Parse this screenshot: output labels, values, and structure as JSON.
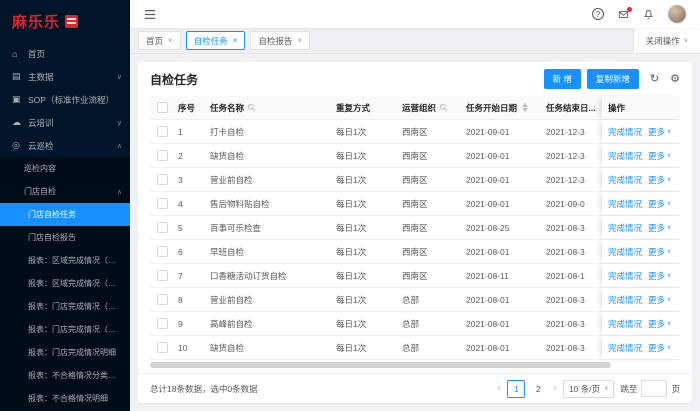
{
  "colors": {
    "primary": "#1890ff",
    "sidebar_bg": "#001529",
    "submenu_bg": "#000c17",
    "brand_red": "#e0242d",
    "badge_red": "#f5222d",
    "page_bg": "#f0f2f5"
  },
  "brand": {
    "name": "麻乐乐"
  },
  "topbar": {
    "help_glyph": "?"
  },
  "icons": {
    "home": "⌂",
    "data": "▤",
    "sop": "▣",
    "cloud": "☁",
    "inspect": "◎"
  },
  "sidebar": {
    "items": [
      {
        "label": "首页",
        "icon": "home"
      },
      {
        "label": "主数据",
        "icon": "data",
        "arrow": "down"
      },
      {
        "label": "SOP（标准作业流程）",
        "icon": "sop"
      },
      {
        "label": "云培训",
        "icon": "cloud",
        "arrow": "down"
      },
      {
        "label": "云巡检",
        "icon": "inspect",
        "arrow": "up"
      },
      {
        "label": "巡检内容",
        "indent": 1,
        "sub": true
      },
      {
        "label": "门店自检",
        "indent": 1,
        "sub": true,
        "arrow": "up"
      },
      {
        "label": "门店自检任务",
        "indent": 2,
        "sub": true,
        "active": true
      },
      {
        "label": "门店自检报告",
        "indent": 2,
        "sub": true
      },
      {
        "label": "报表：区域完成情况（汇总）",
        "indent": 2,
        "sub": true
      },
      {
        "label": "报表：区域完成情况（任务）",
        "indent": 2,
        "sub": true
      },
      {
        "label": "报表：门店完成情况（汇总）",
        "indent": 2,
        "sub": true
      },
      {
        "label": "报表：门店完成情况（任务）",
        "indent": 2,
        "sub": true
      },
      {
        "label": "报表：门店完成情况明细",
        "indent": 2,
        "sub": true
      },
      {
        "label": "报表：不合格情况分类汇总",
        "indent": 2,
        "sub": true
      },
      {
        "label": "报表：不合格情况明细",
        "indent": 2,
        "sub": true
      }
    ]
  },
  "tabs": {
    "items": [
      {
        "label": "首页",
        "active": false
      },
      {
        "label": "自检任务",
        "active": true
      },
      {
        "label": "自检报告",
        "active": false
      }
    ],
    "close_menu": "关闭操作"
  },
  "card": {
    "title": "自检任务",
    "add_btn": "新 增",
    "copy_btn": "复制新增"
  },
  "table": {
    "headers": {
      "no": "序号",
      "name": "任务名称",
      "repeat": "重复方式",
      "org": "运营组织",
      "start": "任务开始日期",
      "end": "任务结束日...",
      "ops": "操作"
    },
    "ops": {
      "complete": "完成情况",
      "more": "更多"
    },
    "rows": [
      {
        "no": "1",
        "name": "打卡自检",
        "repeat": "每日1次",
        "org": "西南区",
        "start": "2021-09-01",
        "end": "2021-12-3"
      },
      {
        "no": "2",
        "name": "缺货自检",
        "repeat": "每日1次",
        "org": "西南区",
        "start": "2021-09-01",
        "end": "2021-12-3"
      },
      {
        "no": "3",
        "name": "营业前自检",
        "repeat": "每日1次",
        "org": "西南区",
        "start": "2021-09-01",
        "end": "2021-12-3"
      },
      {
        "no": "4",
        "name": "售后物料贴自检",
        "repeat": "每日1次",
        "org": "西南区",
        "start": "2021-09-01",
        "end": "2021-09-0"
      },
      {
        "no": "5",
        "name": "百事可乐检查",
        "repeat": "每日1次",
        "org": "西南区",
        "start": "2021-08-25",
        "end": "2021-08-3"
      },
      {
        "no": "6",
        "name": "早班自检",
        "repeat": "每日1次",
        "org": "西南区",
        "start": "2021-08-01",
        "end": "2021-08-3"
      },
      {
        "no": "7",
        "name": "口香糖活动订货自检",
        "repeat": "每日1次",
        "org": "西南区",
        "start": "2021-08-11",
        "end": "2021-08-1"
      },
      {
        "no": "8",
        "name": "营业前自检",
        "repeat": "每日1次",
        "org": "总部",
        "start": "2021-08-01",
        "end": "2021-08-3"
      },
      {
        "no": "9",
        "name": "高峰前自检",
        "repeat": "每日1次",
        "org": "总部",
        "start": "2021-08-01",
        "end": "2021-08-3"
      },
      {
        "no": "10",
        "name": "缺货自检",
        "repeat": "每日1次",
        "org": "总部",
        "start": "2021-08-01",
        "end": "2021-08-3"
      }
    ]
  },
  "pagination": {
    "summary": "总计18条数据，选中0条数据",
    "prev": "‹",
    "next": "›",
    "pages": [
      "1",
      "2"
    ],
    "active_page": "1",
    "page_size": "10 条/页",
    "jump_prefix": "跳至",
    "jump_suffix": "页"
  }
}
